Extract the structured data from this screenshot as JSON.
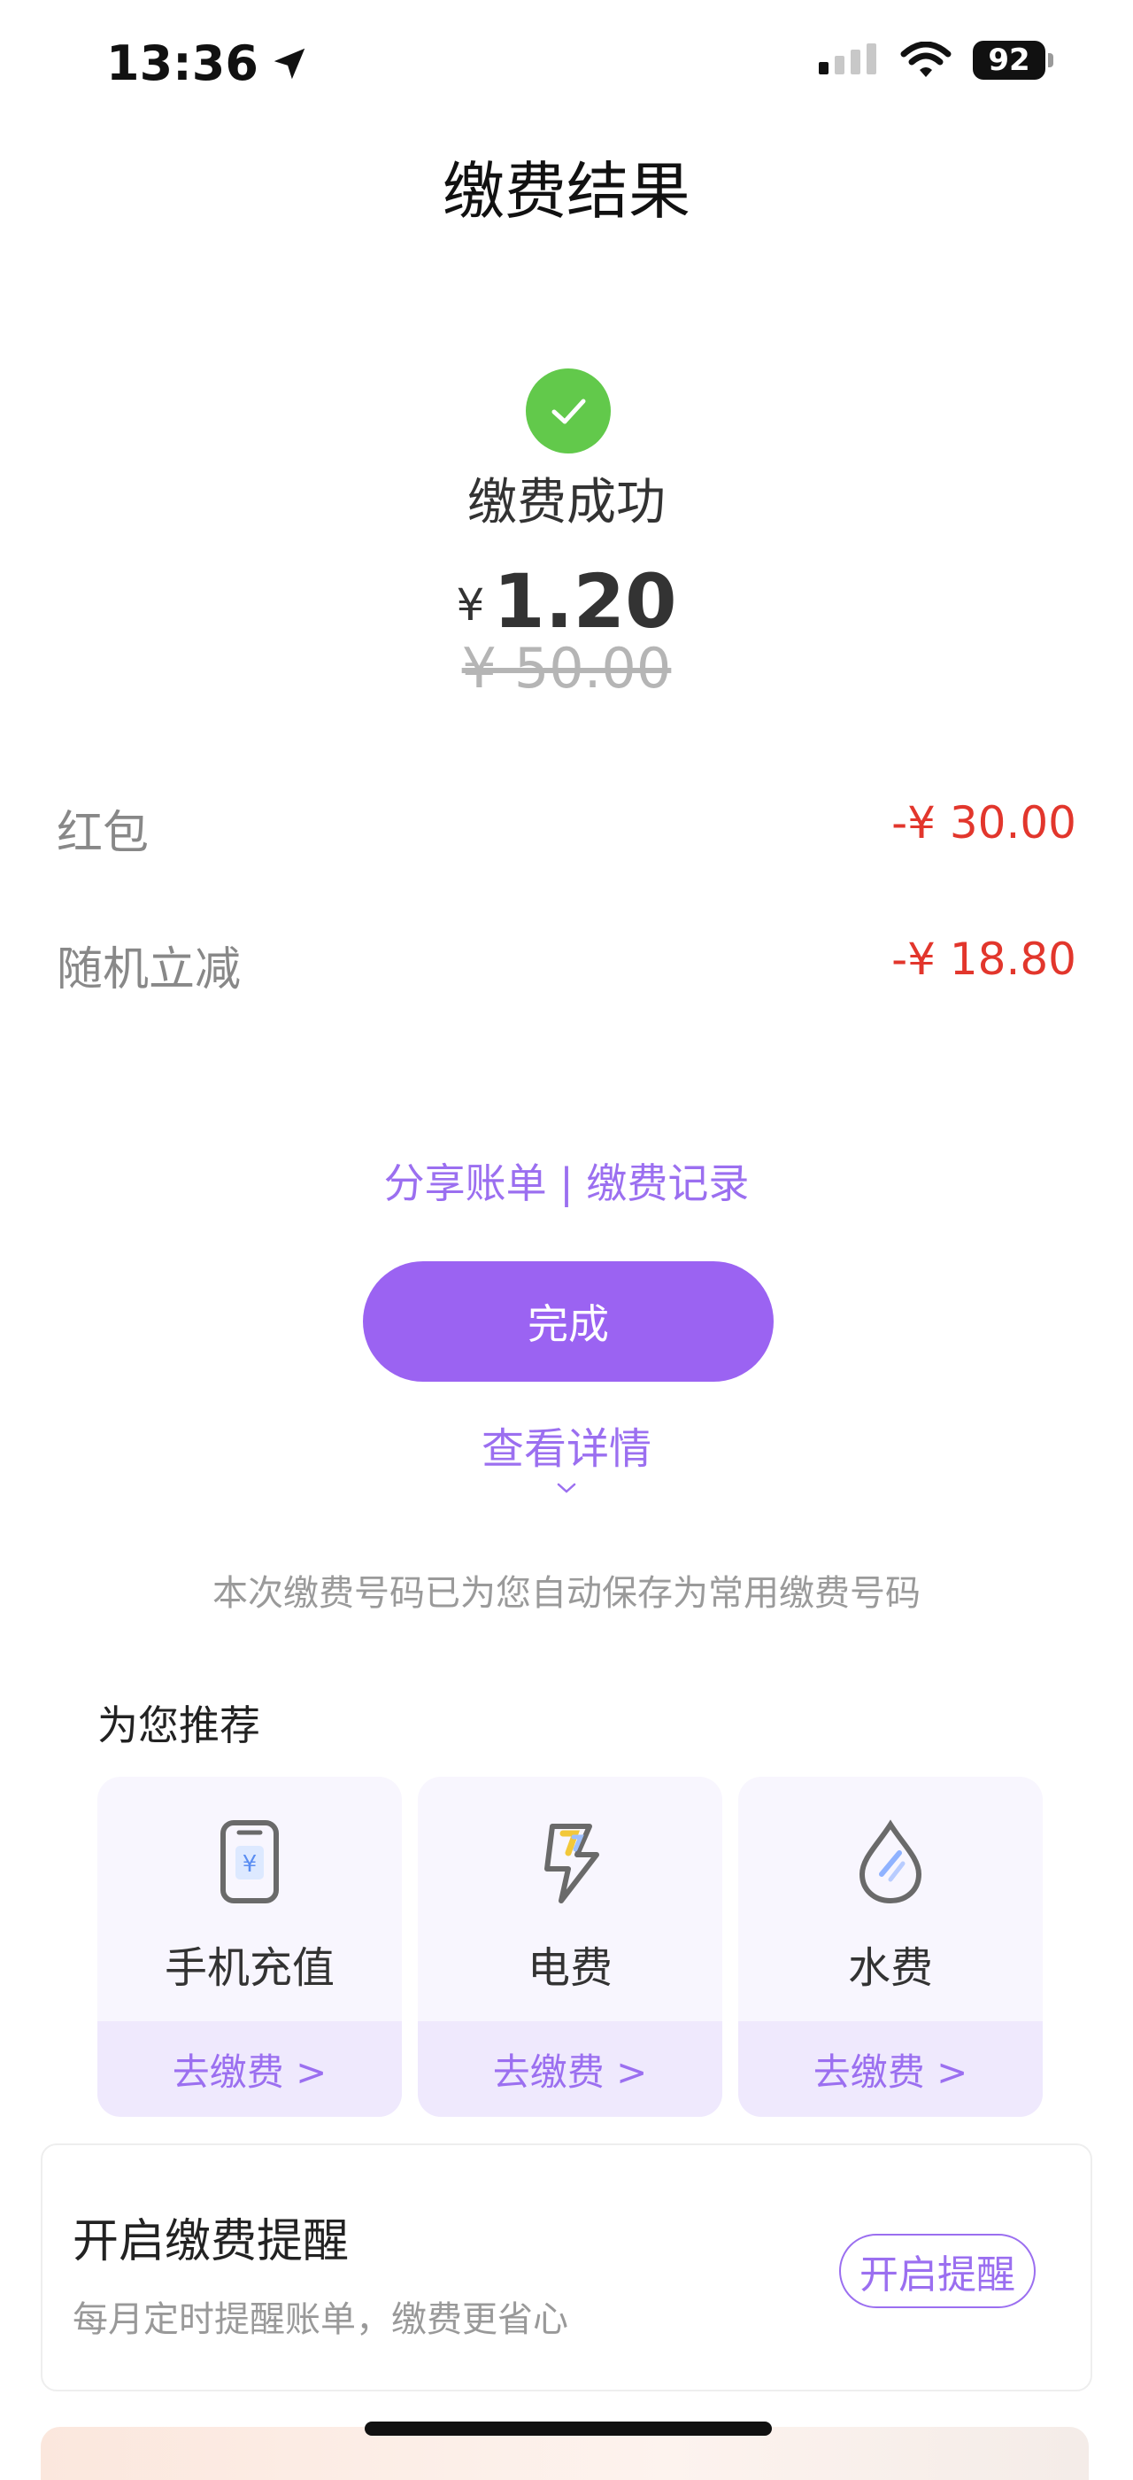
{
  "status_bar": {
    "time": "13:36",
    "battery": "92"
  },
  "header": {
    "title": "缴费结果"
  },
  "result": {
    "status_text": "缴费成功",
    "currency": "¥",
    "amount": "1.20",
    "original_amount": "¥ 50.00"
  },
  "discounts": [
    {
      "label": "红包",
      "value": "-¥ 30.00"
    },
    {
      "label": "随机立减",
      "value": "-¥ 18.80"
    }
  ],
  "links": {
    "share_bill": "分享账单",
    "separator": "|",
    "payment_record": "缴费记录"
  },
  "done_button": "完成",
  "view_details": "查看详情",
  "saved_note": "本次缴费号码已为您自动保存为常用缴费号码",
  "recommend": {
    "title": "为您推荐",
    "items": [
      {
        "label": "手机充值",
        "action": "去缴费 >",
        "icon": "phone-recharge-icon"
      },
      {
        "label": "电费",
        "action": "去缴费 >",
        "icon": "lightning-icon"
      },
      {
        "label": "水费",
        "action": "去缴费 >",
        "icon": "water-drop-icon"
      }
    ]
  },
  "reminder": {
    "title": "开启缴费提醒",
    "subtitle": "每月定时提醒账单，缴费更省心",
    "button": "开启提醒"
  },
  "colors": {
    "accent": "#9b63f2",
    "success": "#62c94b",
    "discount": "#e2362c"
  }
}
